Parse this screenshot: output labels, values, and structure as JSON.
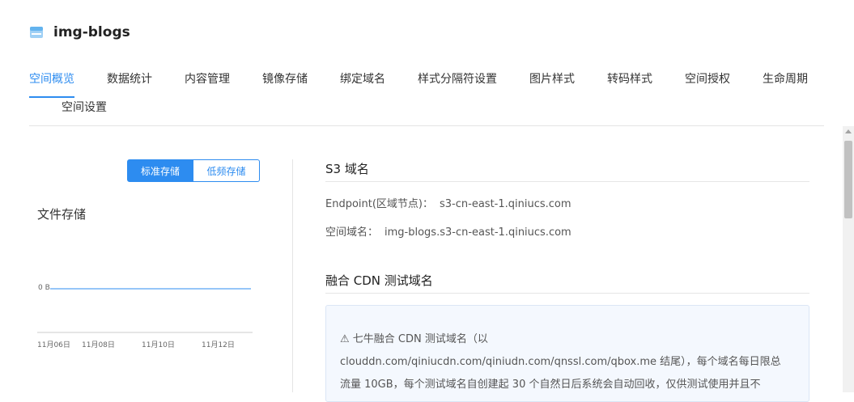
{
  "header": {
    "title": "img-blogs",
    "icon": "bucket-icon"
  },
  "tabs": [
    {
      "label": "空间概览",
      "active": true
    },
    {
      "label": "数据统计"
    },
    {
      "label": "内容管理"
    },
    {
      "label": "镜像存储"
    },
    {
      "label": "绑定域名"
    },
    {
      "label": "样式分隔符设置"
    },
    {
      "label": "图片样式"
    },
    {
      "label": "转码样式"
    },
    {
      "label": "空间授权"
    },
    {
      "label": "生命周期"
    },
    {
      "label": "空间设置"
    }
  ],
  "storage": {
    "segment": {
      "standard": "标准存储",
      "infrequent": "低频存储",
      "selected": "标准存储"
    },
    "title": "文件存储",
    "chart_data": {
      "type": "line",
      "y_tick": "0 B",
      "x": [
        "11月06日",
        "11月08日",
        "11月10日",
        "11月12日"
      ],
      "values": [
        0,
        0,
        0,
        0
      ]
    }
  },
  "s3": {
    "title": "S3 域名",
    "endpoint_label": "Endpoint(区域节点)：",
    "endpoint_value": "s3-cn-east-1.qiniucs.com",
    "bucket_domain_label": "空间域名：",
    "bucket_domain_value": "img-blogs.s3-cn-east-1.qiniucs.com"
  },
  "cdn": {
    "title": "融合 CDN 测试域名",
    "notice_lines": [
      "⚠ 七牛融合 CDN 测试域名（以",
      "clouddn.com/qiniucdn.com/qiniudn.com/qnssl.com/qbox.me 结尾），每个域名每日限总",
      "流量 10GB，每个测试域名自创建起 30 个自然日后系统会自动回收，仅供测试使用并且不"
    ]
  },
  "colors": {
    "accent": "#2d8cf0",
    "divider": "#e4e4e4"
  }
}
